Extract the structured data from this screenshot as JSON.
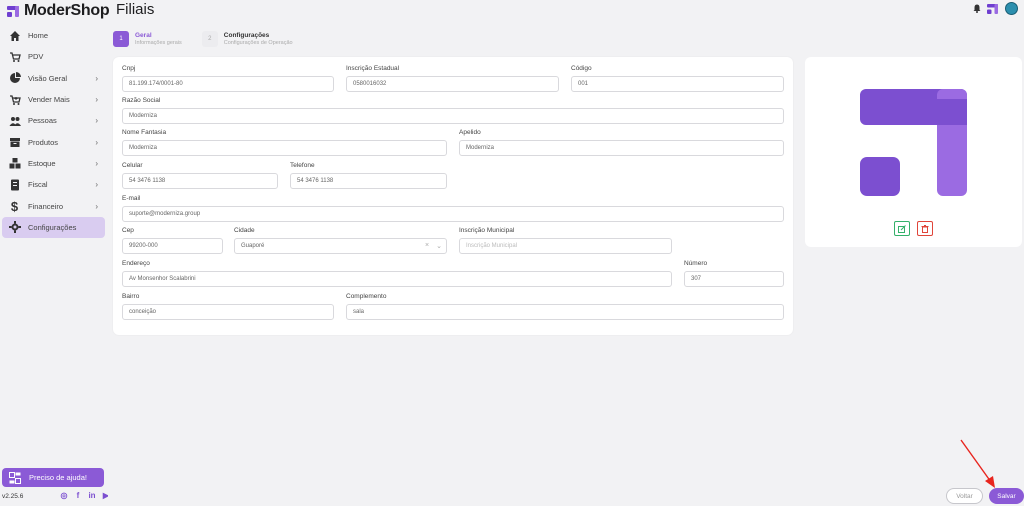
{
  "app": {
    "logo_text": "ModerShop",
    "page_title": "Filiais",
    "version": "v2.25.6"
  },
  "colors": {
    "accent": "#8b5ad6",
    "accent_light": "#d9ccf0",
    "success": "#34b06a",
    "danger": "#e0453a"
  },
  "sidebar": {
    "items": [
      {
        "label": "Home",
        "icon": "home-icon",
        "has_chevron": false
      },
      {
        "label": "PDV",
        "icon": "cart-icon",
        "has_chevron": false
      },
      {
        "label": "Visão Geral",
        "icon": "pie-chart-icon",
        "has_chevron": true
      },
      {
        "label": "Vender Mais",
        "icon": "cart-plus-icon",
        "has_chevron": true
      },
      {
        "label": "Pessoas",
        "icon": "people-icon",
        "has_chevron": true
      },
      {
        "label": "Produtos",
        "icon": "box-icon",
        "has_chevron": true
      },
      {
        "label": "Estoque",
        "icon": "boxes-icon",
        "has_chevron": true
      },
      {
        "label": "Fiscal",
        "icon": "document-icon",
        "has_chevron": true
      },
      {
        "label": "Financeiro",
        "icon": "dollar-icon",
        "has_chevron": true
      },
      {
        "label": "Configurações",
        "icon": "gear-icon",
        "has_chevron": false,
        "active": true
      }
    ],
    "help_label": "Preciso de ajuda!",
    "socials": [
      "instagram-icon",
      "facebook-icon",
      "linkedin-icon",
      "youtube-icon"
    ]
  },
  "stepper": {
    "steps": [
      {
        "num": "1",
        "title": "Geral",
        "subtitle": "Informações gerais",
        "active": true
      },
      {
        "num": "2",
        "title": "Configurações",
        "subtitle": "Configurações de Operação",
        "active": false
      }
    ]
  },
  "form": {
    "cnpj": {
      "label": "Cnpj",
      "value": "81.199.174/0001-80"
    },
    "inscricao_estadual": {
      "label": "Inscrição Estadual",
      "value": "0580016032"
    },
    "codigo": {
      "label": "Código",
      "value": "001"
    },
    "razao_social": {
      "label": "Razão Social",
      "value": "Moderniza"
    },
    "nome_fantasia": {
      "label": "Nome Fantasia",
      "value": "Moderniza"
    },
    "apelido": {
      "label": "Apelido",
      "value": "Moderniza"
    },
    "celular": {
      "label": "Celular",
      "value": "54 3476 1138"
    },
    "telefone": {
      "label": "Telefone",
      "value": "54 3476 1138"
    },
    "email": {
      "label": "E-mail",
      "value": "suporte@moderniza.group"
    },
    "cep": {
      "label": "Cep",
      "value": "99200-000"
    },
    "cidade": {
      "label": "Cidade",
      "value": "Guaporé"
    },
    "inscricao_municipal": {
      "label": "Inscrição Municipal",
      "placeholder": "Inscrição Municipal"
    },
    "endereco": {
      "label": "Endereço",
      "value": "Av Monsenhor Scalabrini"
    },
    "numero": {
      "label": "Número",
      "value": "307"
    },
    "bairro": {
      "label": "Bairro",
      "value": "conceição"
    },
    "complemento": {
      "label": "Complemento",
      "value": "sala"
    }
  },
  "footer": {
    "back_label": "Voltar",
    "save_label": "Salvar"
  }
}
